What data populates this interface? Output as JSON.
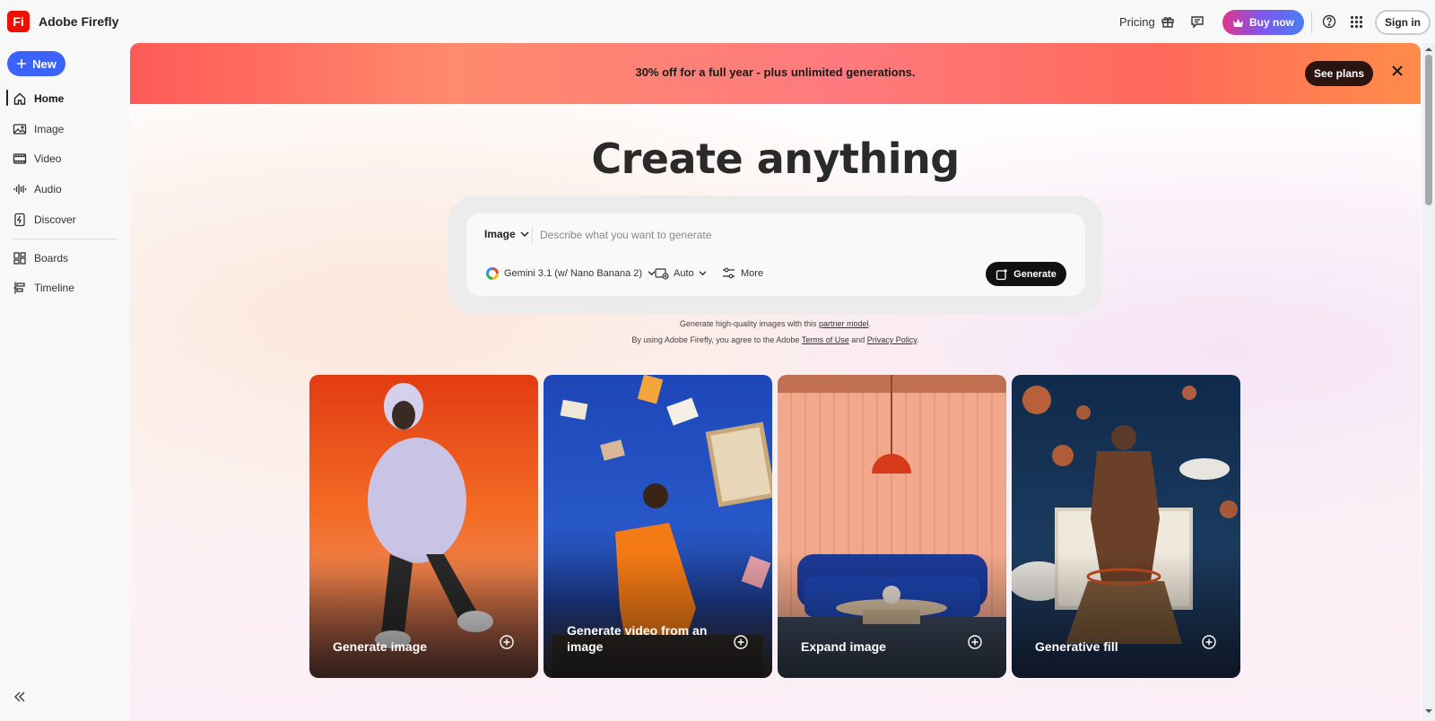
{
  "app": {
    "logo_text": "Fi",
    "title": "Adobe Firefly"
  },
  "header": {
    "pricing": "Pricing",
    "buy_now": "Buy now",
    "sign_in": "Sign in"
  },
  "sidebar": {
    "new_label": "New",
    "items": [
      {
        "label": "Home",
        "icon": "home-icon",
        "active": true
      },
      {
        "label": "Image",
        "icon": "image-icon"
      },
      {
        "label": "Video",
        "icon": "video-icon"
      },
      {
        "label": "Audio",
        "icon": "audio-icon"
      },
      {
        "label": "Discover",
        "icon": "discover-icon"
      },
      {
        "label": "Boards",
        "icon": "boards-icon"
      },
      {
        "label": "Timeline",
        "icon": "timeline-icon"
      }
    ]
  },
  "banner": {
    "text": "30% off for a full year - plus unlimited generations.",
    "cta": "See plans"
  },
  "hero": {
    "title": "Create anything"
  },
  "prompt": {
    "type": "Image",
    "placeholder": "Describe what you want to generate",
    "value": "",
    "model": "Gemini 3.1 (w/ Nano Banana 2)",
    "aspect": "Auto",
    "more": "More",
    "generate": "Generate"
  },
  "notice": {
    "line1_prefix": "Generate high-quality images with this ",
    "line1_link": "partner model",
    "line1_suffix": ".",
    "line2_prefix": "By using Adobe Firefly, you agree to the Adobe ",
    "terms": "Terms of Use",
    "and": " and ",
    "privacy": "Privacy Policy",
    "line2_suffix": "."
  },
  "cards": [
    {
      "label": "Generate image"
    },
    {
      "label": "Generate video from an image"
    },
    {
      "label": "Expand image"
    },
    {
      "label": "Generative fill"
    }
  ],
  "colors": {
    "accent": "#3b63fb",
    "logo_red": "#eb1000",
    "banner_start": "#ff5a57",
    "banner_end": "#ff8c4a"
  }
}
